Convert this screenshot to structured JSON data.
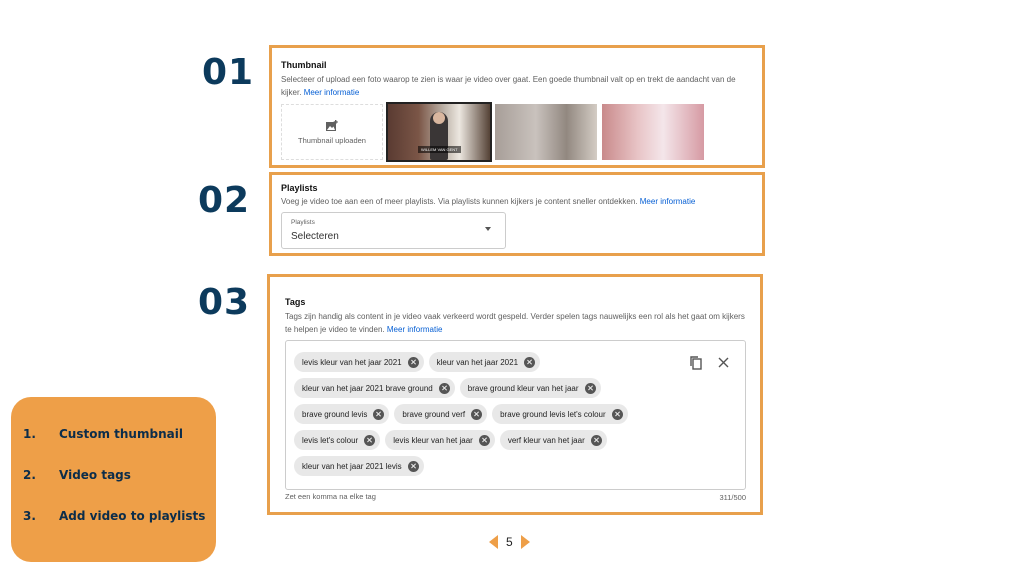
{
  "steps": [
    "01",
    "02",
    "03"
  ],
  "thumbnail": {
    "title": "Thumbnail",
    "description": "Selecteer of upload een foto waarop te zien is waar je video over gaat. Een goede thumbnail valt op en trekt de aandacht van de kijker.",
    "link": "Meer informatie",
    "upload_label": "Thumbnail uploaden",
    "caption": "WILLEM VAN GENT"
  },
  "playlists": {
    "title": "Playlists",
    "description": "Voeg je video toe aan een of meer playlists. Via playlists kunnen kijkers je content sneller ontdekken.",
    "link": "Meer informatie",
    "select_label": "Playlists",
    "select_value": "Selecteren"
  },
  "tags": {
    "title": "Tags",
    "description": "Tags zijn handig als content in je video vaak verkeerd wordt gespeld. Verder spelen tags nauwelijks een rol als het gaat om kijkers te helpen je video te vinden.",
    "link": "Meer informatie",
    "rows": [
      [
        "levis kleur van het jaar 2021",
        "kleur van het jaar 2021"
      ],
      [
        "kleur van het jaar 2021 brave ground",
        "brave ground kleur van het jaar"
      ],
      [
        "brave ground levis",
        "brave ground verf",
        "brave ground levis let's colour"
      ],
      [
        "levis let's colour",
        "levis kleur van het jaar",
        "verf kleur van het jaar"
      ],
      [
        "kleur van het jaar 2021 levis"
      ]
    ],
    "hint": "Zet een komma na elke tag",
    "counter": "311/500"
  },
  "summary": {
    "items": [
      {
        "num": "1.",
        "label": "Custom thumbnail"
      },
      {
        "num": "2.",
        "label": "Video tags"
      },
      {
        "num": "3.",
        "label": "Add video to playlists"
      }
    ]
  },
  "page": {
    "number": "5"
  },
  "colors": {
    "accent": "#ee9f48",
    "navy": "#0c3a5c",
    "link": "#065fd4"
  }
}
